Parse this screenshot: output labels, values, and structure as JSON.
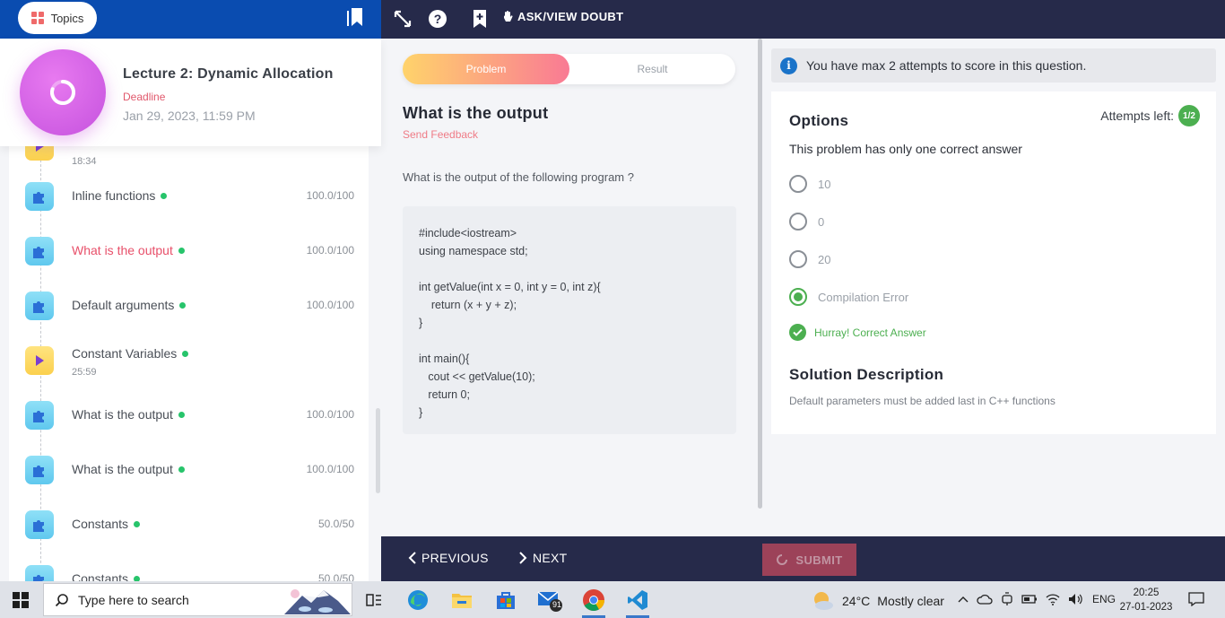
{
  "sidebar": {
    "topics_label": "Topics",
    "lecture_title": "Lecture 2: Dynamic Allocation",
    "deadline_label": "Deadline",
    "deadline_value": "Jan 29, 2023, 11:59 PM",
    "partial_item_time": "18:34",
    "items": [
      {
        "label": "Inline functions",
        "type": "practice",
        "score": "100.0/100",
        "active": false
      },
      {
        "label": "What is the output",
        "type": "practice",
        "score": "100.0/100",
        "active": true
      },
      {
        "label": "Default arguments",
        "type": "practice",
        "score": "100.0/100",
        "active": false
      },
      {
        "label": "Constant Variables",
        "type": "video",
        "duration": "25:59",
        "active": false
      },
      {
        "label": "What is the output",
        "type": "practice",
        "score": "100.0/100",
        "active": false
      },
      {
        "label": "What is the output",
        "type": "practice",
        "score": "100.0/100",
        "active": false
      },
      {
        "label": "Constants",
        "type": "practice",
        "score": "50.0/50",
        "active": false
      },
      {
        "label": "Constants",
        "type": "practice",
        "score": "50.0/50",
        "active": false
      }
    ]
  },
  "topbar": {
    "ask_doubt_label": "ASK/VIEW DOUBT"
  },
  "problem": {
    "tab_problem": "Problem",
    "tab_result": "Result",
    "title": "What is the output",
    "feedback_label": "Send Feedback",
    "question": "What is the output of the following program ?",
    "code_lines": [
      "#include<iostream>",
      "using namespace std;",
      "",
      "int getValue(int x = 0, int y = 0, int z){",
      "    return (x + y + z);",
      "}",
      "",
      "int main(){",
      "   cout << getValue(10);",
      "   return 0;",
      "}"
    ]
  },
  "answer": {
    "info_message": "You have max 2 attempts to score in this question.",
    "options_title": "Options",
    "attempts_label": "Attempts left:",
    "attempts_value": "1/2",
    "hint": "This problem has only one correct answer",
    "options": [
      {
        "text": "10",
        "selected": false
      },
      {
        "text": "0",
        "selected": false
      },
      {
        "text": "20",
        "selected": false
      },
      {
        "text": "Compilation Error",
        "selected": true
      }
    ],
    "correct_message": "Hurray! Correct Answer",
    "solution_title": "Solution Description",
    "solution_text": "Default parameters must be added last in C++ functions"
  },
  "bottom_nav": {
    "previous_label": "PREVIOUS",
    "next_label": "NEXT",
    "submit_label": "SUBMIT"
  },
  "taskbar": {
    "search_placeholder": "Type here to search",
    "mail_badge": "91",
    "temperature": "24°C",
    "weather_text": "Mostly clear",
    "language": "ENG",
    "time": "20:25",
    "date": "27-01-2023"
  },
  "colors": {
    "header_blue": "#0a4cb0",
    "dark_bar": "#262a4a",
    "accent_pink": "#e8506a",
    "success_green": "#4caf50",
    "info_blue": "#1a73c9"
  }
}
